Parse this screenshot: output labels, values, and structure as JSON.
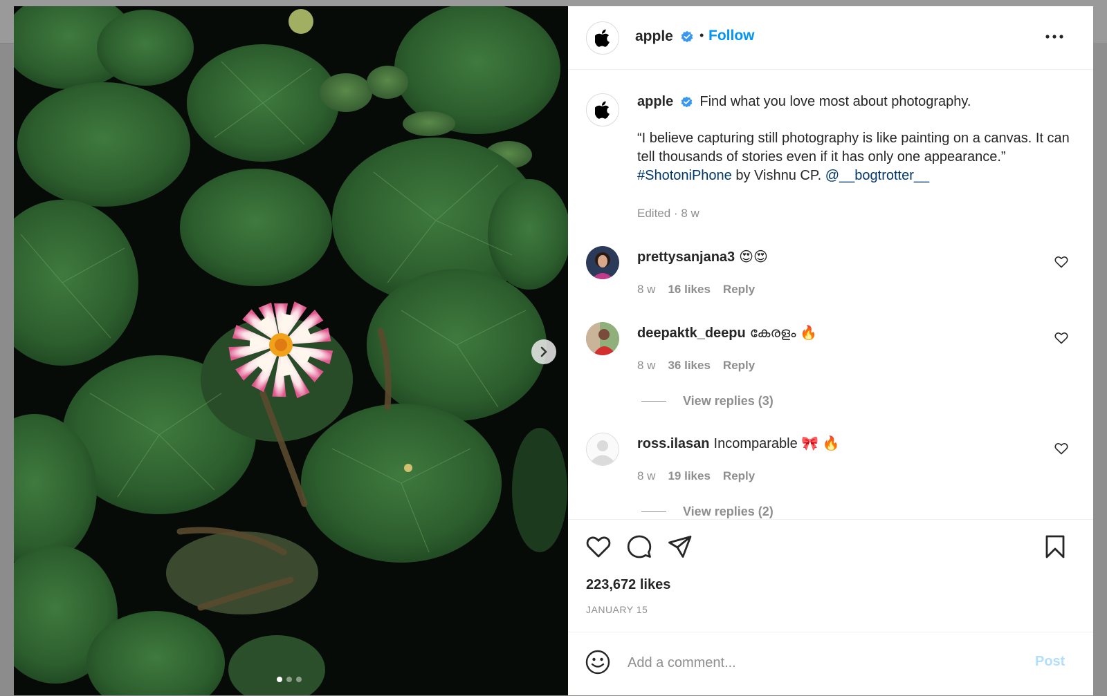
{
  "colors": {
    "accent": "#0095f6",
    "link": "#00376b",
    "muted": "#8e8e8e",
    "post_disabled": "#b2dffc"
  },
  "header": {
    "username": "apple",
    "separator": "•",
    "follow_label": "Follow",
    "icons": [
      "apple-logo-icon",
      "verified-badge-icon",
      "more-options-icon"
    ]
  },
  "caption": {
    "username": "apple",
    "line1": "Find what you love most about photography.",
    "quote": "“I believe capturing still photography is like painting on a canvas. It can tell thousands of stories even if it has only one appearance.”",
    "hashtag": "#ShotoniPhone",
    "by_text": "by Vishnu CP.",
    "mention": "@__bogtrotter__",
    "edited": "Edited",
    "dot": "·",
    "time": "8 w"
  },
  "comments": [
    {
      "username": "prettysanjana3",
      "text": "😍😍",
      "time": "8 w",
      "likes": "16 likes",
      "reply": "Reply"
    },
    {
      "username": "deepaktk_deepu",
      "text": "കേരളം 🔥",
      "time": "8 w",
      "likes": "36 likes",
      "reply": "Reply",
      "view_replies": "View replies (3)"
    },
    {
      "username": "ross.ilasan",
      "text": "Incomparable 🎀 🔥",
      "time": "8 w",
      "likes": "19 likes",
      "reply": "Reply",
      "view_replies": "View replies (2)"
    }
  ],
  "actions": {
    "icons": [
      "heart-icon",
      "comment-icon",
      "share-icon",
      "bookmark-icon"
    ],
    "likes": "223,672 likes",
    "date": "JANUARY 15"
  },
  "add_comment": {
    "placeholder": "Add a comment...",
    "post_label": "Post"
  },
  "carousel": {
    "slides": 3,
    "active": 1
  }
}
